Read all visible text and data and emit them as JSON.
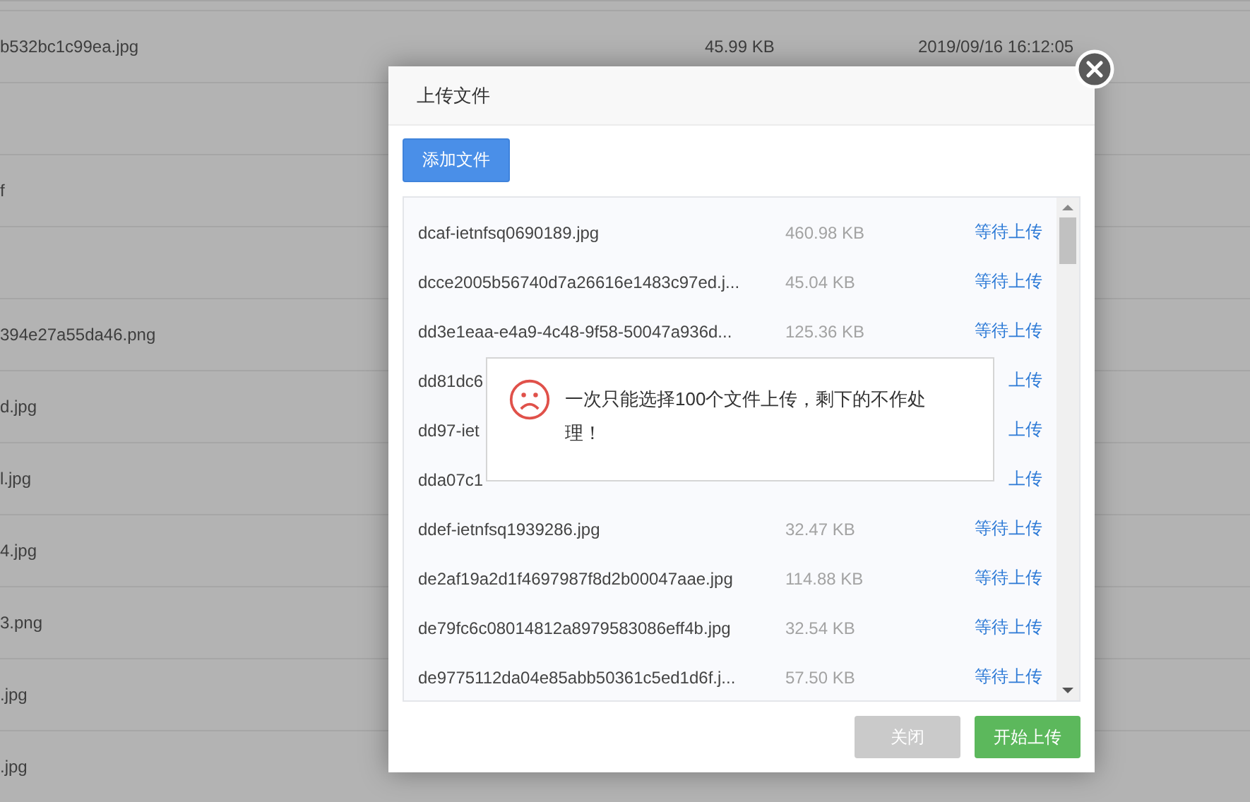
{
  "background_table": {
    "rows": [
      {
        "name": "b532bc1c99ea.jpg",
        "size": "45.99 KB",
        "date": "2019/09/16 16:12:05"
      },
      {
        "name": ""
      },
      {
        "name": "f"
      },
      {
        "name": ""
      },
      {
        "name": "394e27a55da46.png"
      },
      {
        "name": "d.jpg"
      },
      {
        "name": "l.jpg"
      },
      {
        "name": "4.jpg"
      },
      {
        "name": "3.png"
      },
      {
        "name": ".jpg"
      },
      {
        "name": ".jpg"
      }
    ]
  },
  "dialog": {
    "title": "上传文件",
    "add_button": "添加文件",
    "files": [
      {
        "name": "dcaf-ietnfsq0690189.jpg",
        "size": "460.98 KB",
        "status": "等待上传"
      },
      {
        "name": "dcce2005b56740d7a26616e1483c97ed.j...",
        "size": "45.04 KB",
        "status": "等待上传"
      },
      {
        "name": "dd3e1eaa-e4a9-4c48-9f58-50047a936d...",
        "size": "125.36 KB",
        "status": "等待上传"
      },
      {
        "name": "dd81dc6",
        "status": "上传"
      },
      {
        "name": "dd97-iet",
        "status": "上传"
      },
      {
        "name": "dda07c1",
        "status": "上传"
      },
      {
        "name": "ddef-ietnfsq1939286.jpg",
        "size": "32.47 KB",
        "status": "等待上传"
      },
      {
        "name": "de2af19a2d1f4697987f8d2b00047aae.jpg",
        "size": "114.88 KB",
        "status": "等待上传"
      },
      {
        "name": "de79fc6c08014812a8979583086eff4b.jpg",
        "size": "32.54 KB",
        "status": "等待上传"
      },
      {
        "name": "de9775112da04e85abb50361c5ed1d6f.j...",
        "size": "57.50 KB",
        "status": "等待上传"
      }
    ],
    "buttons": [
      {
        "label": "关闭",
        "disabled": true
      },
      {
        "label": "开始上传",
        "disabled": false
      }
    ],
    "toast": {
      "message": "一次只能选择100个文件上传，剩下的不作处理！"
    }
  }
}
